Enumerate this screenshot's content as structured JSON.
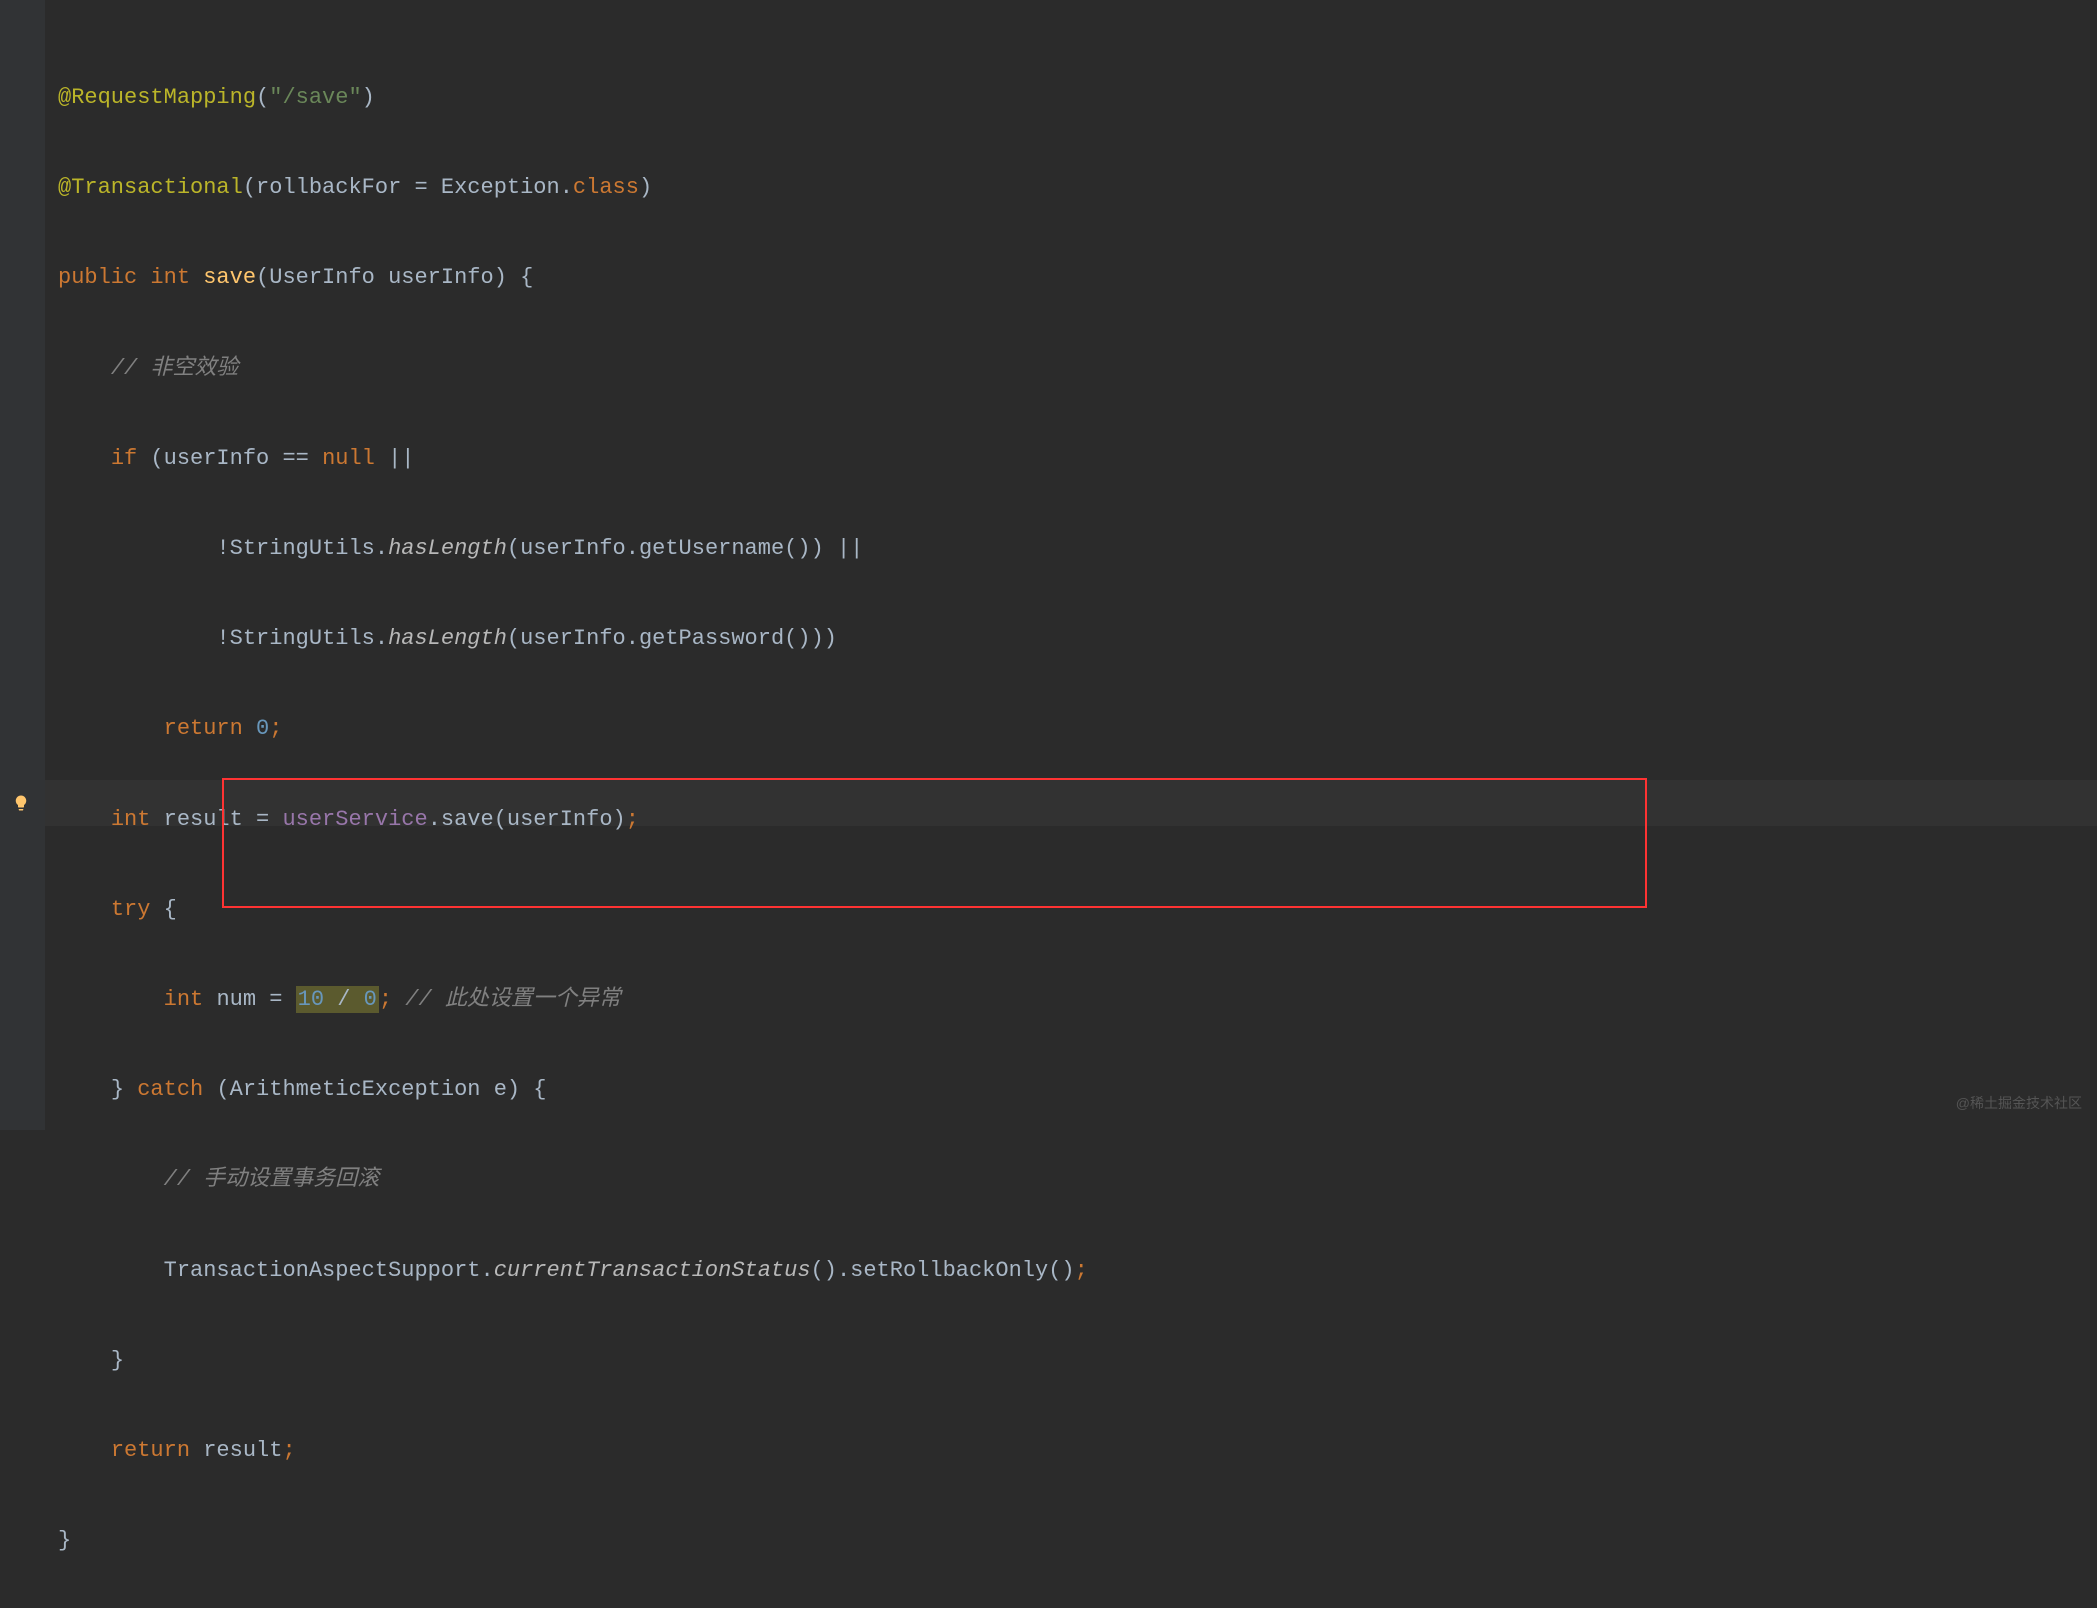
{
  "code": {
    "line1": {
      "annotation": "@RequestMapping",
      "paren_open": "(",
      "string": "\"/save\"",
      "paren_close": ")"
    },
    "line2": {
      "annotation": "@Transactional",
      "paren_open": "(",
      "param": "rollbackFor",
      "eq": " = ",
      "class_ref": "Exception",
      "dot": ".",
      "class_kw": "class",
      "paren_close": ")"
    },
    "line3": {
      "public": "public",
      "int": "int",
      "method": "save",
      "paren_open": "(",
      "type": "UserInfo",
      "param": "userInfo",
      "paren_close": ")",
      "brace": " {"
    },
    "line4": {
      "comment": "// 非空效验"
    },
    "line5": {
      "if": "if",
      "paren_open": " (",
      "var": "userInfo",
      "eq": " == ",
      "null": "null",
      "or": " ||"
    },
    "line6": {
      "not": "!",
      "class": "StringUtils",
      "dot": ".",
      "method": "hasLength",
      "paren_open": "(",
      "var": "userInfo",
      "dot2": ".",
      "getter": "getUsername",
      "call": "()",
      "paren_close": ")",
      "or": " ||"
    },
    "line7": {
      "not": "!",
      "class": "StringUtils",
      "dot": ".",
      "method": "hasLength",
      "paren_open": "(",
      "var": "userInfo",
      "dot2": ".",
      "getter": "getPassword",
      "call": "()",
      "paren_close": "))"
    },
    "line8": {
      "return": "return",
      "value": "0",
      "semi": ";"
    },
    "line9": {
      "int": "int",
      "var": "result",
      "eq": " = ",
      "service": "userService",
      "dot": ".",
      "method": "save",
      "paren_open": "(",
      "arg": "userInfo",
      "paren_close": ")",
      "semi": ";"
    },
    "line10": {
      "try": "try",
      "brace": " {"
    },
    "line11": {
      "int": "int",
      "var": "num",
      "eq": " = ",
      "n1": "10",
      "div": " / ",
      "n2": "0",
      "semi": ";",
      "comment": " // 此处设置一个异常"
    },
    "line12": {
      "brace_close": "}",
      "catch": " catch",
      "paren_open": " (",
      "type": "ArithmeticException",
      "var": "e",
      "paren_close": ")",
      "brace": " {"
    },
    "line13": {
      "comment": "// 手动设置事务回滚"
    },
    "line14": {
      "class": "TransactionAspectSupport",
      "dot": ".",
      "method": "currentTransactionStatus",
      "call": "()",
      "dot2": ".",
      "setter": "setRollbackOnly",
      "call2": "()",
      "semi": ";"
    },
    "line15": {
      "brace": "}"
    },
    "line16": {
      "return": "return",
      "var": "result",
      "semi": ";"
    },
    "line17": {
      "brace": "}"
    }
  },
  "watermark": "@稀土掘金技术社区"
}
